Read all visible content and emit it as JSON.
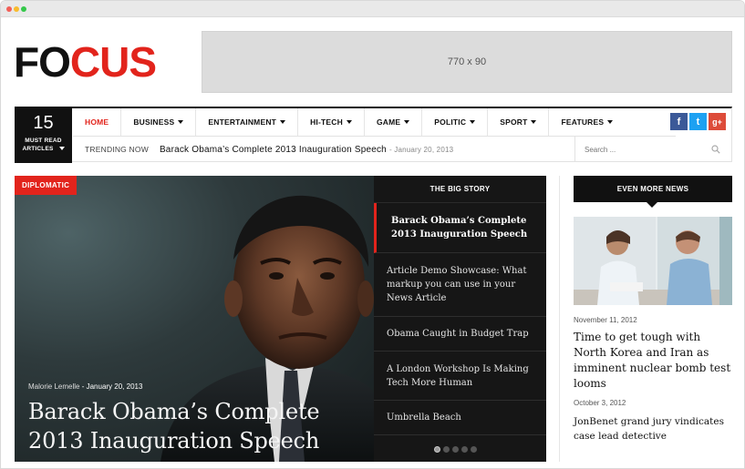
{
  "header": {
    "logo_part1": "FO",
    "logo_part2": "CUS",
    "ad_label": "770 x 90"
  },
  "counter": {
    "number": "15",
    "label_line1": "MUST READ",
    "label_line2": "ARTICLES"
  },
  "menu": [
    {
      "label": "HOME",
      "dropdown": false,
      "active": true
    },
    {
      "label": "BUSINESS",
      "dropdown": true,
      "active": false
    },
    {
      "label": "ENTERTAINMENT",
      "dropdown": true,
      "active": false
    },
    {
      "label": "HI-TECH",
      "dropdown": true,
      "active": false
    },
    {
      "label": "GAME",
      "dropdown": true,
      "active": false
    },
    {
      "label": "POLITIC",
      "dropdown": true,
      "active": false
    },
    {
      "label": "SPORT",
      "dropdown": true,
      "active": false
    },
    {
      "label": "FEATURES",
      "dropdown": true,
      "active": false
    }
  ],
  "social": {
    "facebook": "f",
    "twitter": "t",
    "googleplus": "g+"
  },
  "trending": {
    "label": "TRENDING NOW",
    "title": "Barack Obama’s Complete 2013 Inauguration Speech",
    "date": "- January 20, 2013"
  },
  "search": {
    "placeholder": "Search ..."
  },
  "hero": {
    "tag": "DIPLOMATIC",
    "author": "Malorie Lemelle",
    "date": "- January 20, 2013",
    "title": "Barack Obama’s Complete 2013 Inauguration Speech"
  },
  "bigstory": {
    "heading": "THE BIG STORY",
    "items": [
      {
        "title": "Barack Obama’s Complete 2013 Inauguration Speech"
      },
      {
        "title": "Article Demo Showcase: What markup you can use in your News Article"
      },
      {
        "title": "Obama Caught in Budget Trap"
      },
      {
        "title": "A London Workshop Is Making Tech More Human"
      },
      {
        "title": "Umbrella Beach"
      }
    ],
    "active_slide": 1,
    "slide_count": 5
  },
  "sidebar": {
    "heading": "EVEN MORE NEWS",
    "posts": [
      {
        "date": "November 11, 2012",
        "title": "Time to get tough with North Korea and Iran as imminent nuclear bomb test looms"
      },
      {
        "date": "October 3, 2012",
        "title": "JonBenet grand jury vindicates case lead detective"
      }
    ]
  },
  "colors": {
    "accent": "#e2241c",
    "dark": "#111111"
  }
}
